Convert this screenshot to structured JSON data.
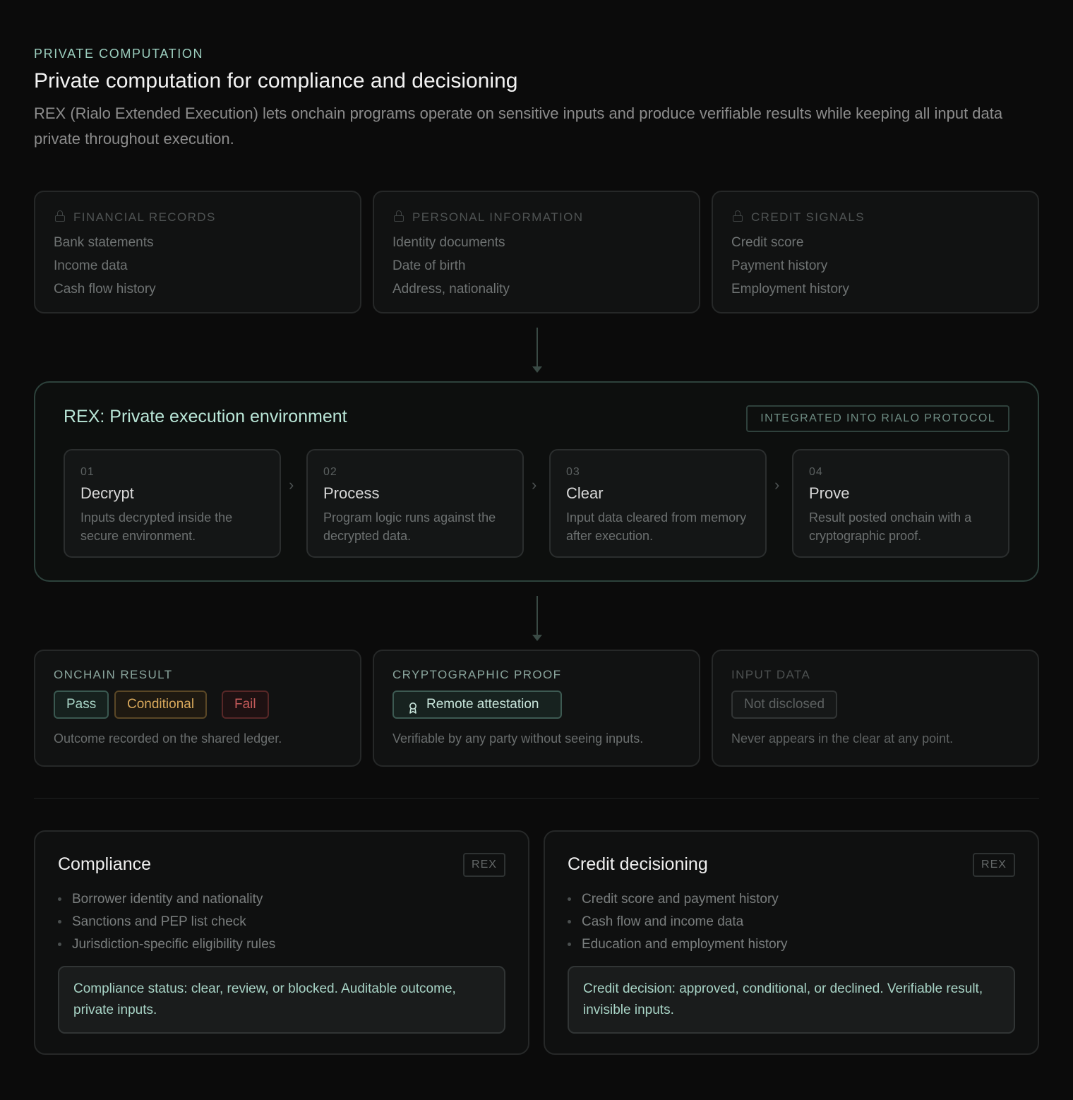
{
  "header": {
    "eyebrow": "PRIVATE COMPUTATION",
    "title": "Private computation for compliance and decisioning",
    "subtitle": "REX (Rialo Extended Execution) lets onchain programs operate on sensitive inputs and produce verifiable results while keeping all input data private throughout execution."
  },
  "inputs": [
    {
      "icon": "lock-icon",
      "heading": "FINANCIAL RECORDS",
      "items": [
        "Bank statements",
        "Income data",
        "Cash flow history"
      ]
    },
    {
      "icon": "lock-icon",
      "heading": "PERSONAL INFORMATION",
      "items": [
        "Identity documents",
        "Date of birth",
        "Address, nationality"
      ]
    },
    {
      "icon": "lock-icon",
      "heading": "CREDIT SIGNALS",
      "items": [
        "Credit score",
        "Payment history",
        "Employment history"
      ]
    }
  ],
  "rex": {
    "title": "REX: Private execution environment",
    "badge": "INTEGRATED INTO RIALO PROTOCOL",
    "steps": [
      {
        "num": "01",
        "name": "Decrypt",
        "desc": "Inputs decrypted inside the secure environment."
      },
      {
        "num": "02",
        "name": "Process",
        "desc": "Program logic runs against the decrypted data."
      },
      {
        "num": "03",
        "name": "Clear",
        "desc": "Input data cleared from memory after execution."
      },
      {
        "num": "04",
        "name": "Prove",
        "desc": "Result posted onchain with a cryptographic proof."
      }
    ],
    "separator": "›"
  },
  "outputs": {
    "result": {
      "heading": "ONCHAIN RESULT",
      "pills": [
        "Pass",
        "Conditional",
        "Fail"
      ],
      "desc": "Outcome recorded on the shared ledger."
    },
    "proof": {
      "heading": "CRYPTOGRAPHIC PROOF",
      "pill": "Remote attestation",
      "icon": "badge-icon",
      "desc": "Verifiable by any party without seeing inputs."
    },
    "input": {
      "heading": "INPUT DATA",
      "pill": "Not disclosed",
      "desc": "Never appears in the clear at any point."
    }
  },
  "use_cases": [
    {
      "title": "Compliance",
      "badge": "REX",
      "items": [
        "Borrower identity and nationality",
        "Sanctions and PEP list check",
        "Jurisdiction-specific eligibility rules"
      ],
      "summary": "Compliance status: clear, review, or blocked. Auditable outcome, private inputs."
    },
    {
      "title": "Credit decisioning",
      "badge": "REX",
      "items": [
        "Credit score and payment history",
        "Cash flow and income data",
        "Education and employment history"
      ],
      "summary": "Credit decision: approved, conditional, or declined. Verifiable result, invisible inputs."
    }
  ],
  "colors": {
    "background": "#0b0b0b",
    "accent": "#9ccfbf",
    "pass": "#a8d4c6",
    "conditional": "#d9a95c",
    "fail": "#c45a5a"
  }
}
